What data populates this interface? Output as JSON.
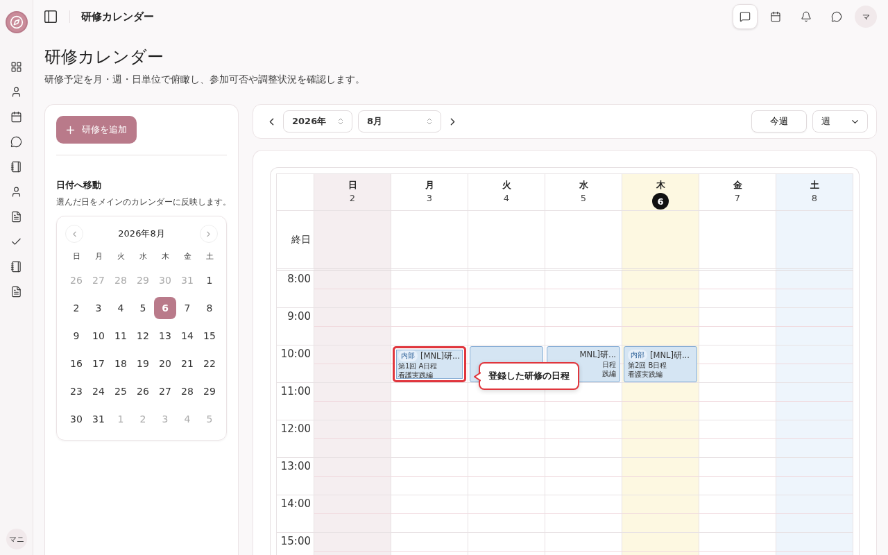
{
  "header": {
    "title": "研修カレンダー",
    "actions": [
      {
        "kind": "note",
        "selected": true
      },
      {
        "kind": "calendar",
        "selected": false
      },
      {
        "kind": "bell",
        "selected": false
      },
      {
        "kind": "chat",
        "selected": false
      }
    ],
    "avatar": "マ"
  },
  "sidebar": {
    "user": "マニ"
  },
  "page": {
    "title": "研修カレンダー",
    "subtitle": "研修予定を月・週・日単位で俯瞰し、参加可否や調整状況を確認します。"
  },
  "left_panel": {
    "add_button": "研修を追加",
    "section_title": "日付へ移動",
    "section_hint": "選んだ日をメインのカレンダーに反映します。",
    "mini_calendar": {
      "title": "2026年8月",
      "weekdays": [
        "日",
        "月",
        "火",
        "水",
        "木",
        "金",
        "土"
      ],
      "days": [
        {
          "label": "26",
          "muted": true,
          "selected": false
        },
        {
          "label": "27",
          "muted": true,
          "selected": false
        },
        {
          "label": "28",
          "muted": true,
          "selected": false
        },
        {
          "label": "29",
          "muted": true,
          "selected": false
        },
        {
          "label": "30",
          "muted": true,
          "selected": false
        },
        {
          "label": "31",
          "muted": true,
          "selected": false
        },
        {
          "label": "1",
          "muted": false,
          "selected": false
        },
        {
          "label": "2",
          "muted": false,
          "selected": false
        },
        {
          "label": "3",
          "muted": false,
          "selected": false
        },
        {
          "label": "4",
          "muted": false,
          "selected": false
        },
        {
          "label": "5",
          "muted": false,
          "selected": false
        },
        {
          "label": "6",
          "muted": false,
          "selected": true
        },
        {
          "label": "7",
          "muted": false,
          "selected": false
        },
        {
          "label": "8",
          "muted": false,
          "selected": false
        },
        {
          "label": "9",
          "muted": false,
          "selected": false
        },
        {
          "label": "10",
          "muted": false,
          "selected": false
        },
        {
          "label": "11",
          "muted": false,
          "selected": false
        },
        {
          "label": "12",
          "muted": false,
          "selected": false
        },
        {
          "label": "13",
          "muted": false,
          "selected": false
        },
        {
          "label": "14",
          "muted": false,
          "selected": false
        },
        {
          "label": "15",
          "muted": false,
          "selected": false
        },
        {
          "label": "16",
          "muted": false,
          "selected": false
        },
        {
          "label": "17",
          "muted": false,
          "selected": false
        },
        {
          "label": "18",
          "muted": false,
          "selected": false
        },
        {
          "label": "19",
          "muted": false,
          "selected": false
        },
        {
          "label": "20",
          "muted": false,
          "selected": false
        },
        {
          "label": "21",
          "muted": false,
          "selected": false
        },
        {
          "label": "22",
          "muted": false,
          "selected": false
        },
        {
          "label": "23",
          "muted": false,
          "selected": false
        },
        {
          "label": "24",
          "muted": false,
          "selected": false
        },
        {
          "label": "25",
          "muted": false,
          "selected": false
        },
        {
          "label": "26",
          "muted": false,
          "selected": false
        },
        {
          "label": "27",
          "muted": false,
          "selected": false
        },
        {
          "label": "28",
          "muted": false,
          "selected": false
        },
        {
          "label": "29",
          "muted": false,
          "selected": false
        },
        {
          "label": "30",
          "muted": false,
          "selected": false
        },
        {
          "label": "31",
          "muted": false,
          "selected": false
        },
        {
          "label": "1",
          "muted": true,
          "selected": false
        },
        {
          "label": "2",
          "muted": true,
          "selected": false
        },
        {
          "label": "3",
          "muted": true,
          "selected": false
        },
        {
          "label": "4",
          "muted": true,
          "selected": false
        },
        {
          "label": "5",
          "muted": true,
          "selected": false
        }
      ]
    }
  },
  "toolbar": {
    "year": "2026年",
    "month": "8月",
    "today_button": "今週",
    "view": "週"
  },
  "calendar": {
    "all_day_label": "終日",
    "days": [
      {
        "weekday": "日",
        "date": "2",
        "kind": "sunday"
      },
      {
        "weekday": "月",
        "date": "3",
        "kind": "weekday"
      },
      {
        "weekday": "火",
        "date": "4",
        "kind": "weekday"
      },
      {
        "weekday": "水",
        "date": "5",
        "kind": "weekday"
      },
      {
        "weekday": "木",
        "date": "6",
        "kind": "today"
      },
      {
        "weekday": "金",
        "date": "7",
        "kind": "weekday"
      },
      {
        "weekday": "土",
        "date": "8",
        "kind": "saturday"
      }
    ],
    "hours": [
      {
        "label": "8:00"
      },
      {
        "label": "9:00"
      },
      {
        "label": "10:00",
        "slots": [
          {
            "kind": "empty"
          },
          {
            "kind": "full",
            "badge": "内部",
            "title": "[MNL]研...",
            "lines": [
              "第1回 A日程",
              "看護実践編"
            ],
            "highlighted": true
          },
          {
            "kind": "covered",
            "highlighted": false
          },
          {
            "kind": "covered",
            "title": "MNL]研...",
            "lines": [
              "日程",
              "践編"
            ],
            "highlighted": false
          },
          {
            "kind": "full",
            "badge": "内部",
            "title": "[MNL]研...",
            "lines": [
              "第2回 B日程",
              "看護実践編"
            ],
            "highlighted": false
          },
          {
            "kind": "empty"
          },
          {
            "kind": "empty"
          }
        ]
      },
      {
        "label": "11:00"
      },
      {
        "label": "12:00"
      },
      {
        "label": "13:00"
      },
      {
        "label": "14:00"
      },
      {
        "label": "15:00"
      }
    ]
  },
  "callout": {
    "text": "登録した研修の日程"
  }
}
